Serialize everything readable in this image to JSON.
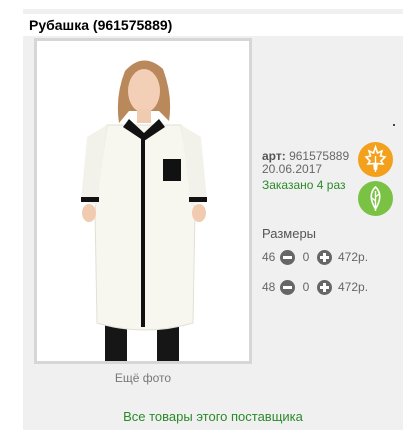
{
  "product": {
    "title": "Рубашка (961575889)",
    "art_label": "арт:",
    "art_value": "961575889",
    "date": "20.06.2017",
    "ordered": "Заказано 4 раз",
    "more_photo": "Ещё фото"
  },
  "sizes": {
    "label": "Размеры",
    "rows": [
      {
        "size": "46",
        "qty": "0",
        "price": "472р."
      },
      {
        "size": "48",
        "qty": "0",
        "price": "472р."
      }
    ]
  },
  "icons": {
    "leaf": "maple-leaf-icon",
    "eco": "green-leaf-icon",
    "minus": "minus-circle-icon",
    "plus": "plus-circle-icon"
  },
  "colors": {
    "accent_green": "#2a8a2a",
    "badge_orange": "#f3a01c",
    "badge_green": "#7ac243"
  },
  "supplier_link": "Все товары этого поставщика"
}
